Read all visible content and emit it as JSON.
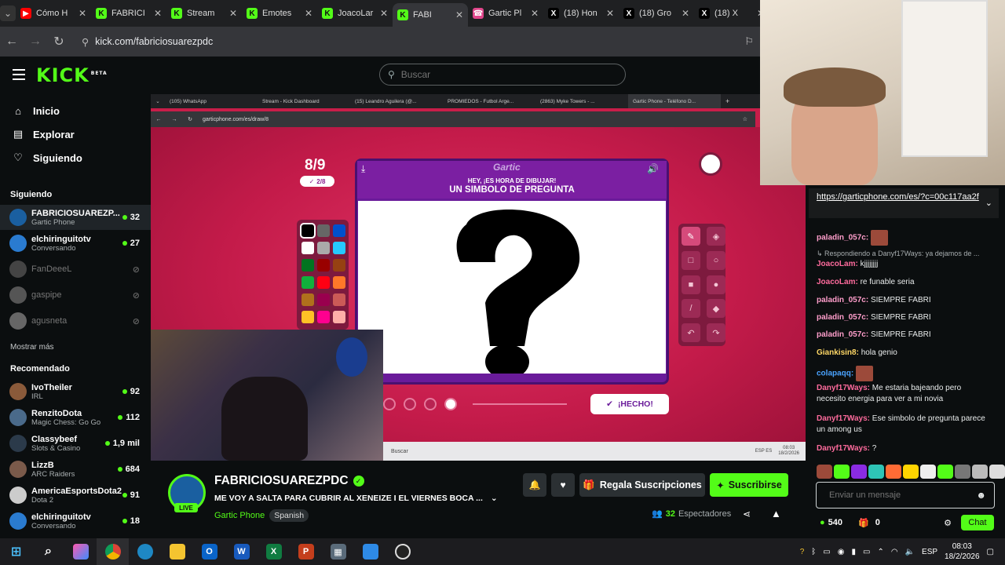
{
  "browser": {
    "tabs": [
      {
        "label": "Cómo H",
        "fav": "▶",
        "color": "#ff0000"
      },
      {
        "label": "FABRICI",
        "fav": "K",
        "color": "#53fc18"
      },
      {
        "label": "Stream",
        "fav": "K",
        "color": "#53fc18"
      },
      {
        "label": "Emotes",
        "fav": "K",
        "color": "#53fc18"
      },
      {
        "label": "JoacoLar",
        "fav": "K",
        "color": "#53fc18"
      },
      {
        "label": "FABI",
        "fav": "K",
        "color": "#53fc18"
      },
      {
        "label": "Gartic Pl",
        "fav": "☎",
        "color": "#e0468b"
      },
      {
        "label": "(18) Hon",
        "fav": "X",
        "color": "#000000"
      },
      {
        "label": "(18) Gro",
        "fav": "X",
        "color": "#000000"
      },
      {
        "label": "(18) X",
        "fav": "X",
        "color": "#000000"
      }
    ],
    "url": "kick.com/fabriciosuarezpdc"
  },
  "kick": {
    "logo": "KICK",
    "logo_beta": "BETA",
    "search_placeholder": "Buscar",
    "nav": [
      {
        "label": "Inicio"
      },
      {
        "label": "Explorar"
      },
      {
        "label": "Siguiendo"
      }
    ],
    "following_header": "Siguiendo",
    "following": [
      {
        "name": "FABRICIOSUAREZP...",
        "cat": "Gartic Phone",
        "viewers": "32",
        "live": true,
        "color": "#1a5fa0"
      },
      {
        "name": "elchiringuitotv",
        "cat": "Conversando",
        "viewers": "27",
        "live": true,
        "color": "#2a7bd0"
      },
      {
        "name": "FanDeeeL",
        "cat": "",
        "viewers": "",
        "live": false,
        "color": "#444"
      },
      {
        "name": "gaspipe",
        "cat": "",
        "viewers": "",
        "live": false,
        "color": "#555"
      },
      {
        "name": "agusneta",
        "cat": "",
        "viewers": "",
        "live": false,
        "color": "#666"
      }
    ],
    "show_more": "Mostrar más",
    "recommended_header": "Recomendado",
    "recommended": [
      {
        "name": "IvoTheiler",
        "cat": "IRL",
        "viewers": "92",
        "color": "#8a5a3a"
      },
      {
        "name": "RenzitoDota",
        "cat": "Magic Chess: Go Go",
        "viewers": "112",
        "color": "#4a6a8a"
      },
      {
        "name": "Classybeef",
        "cat": "Slots & Casino",
        "viewers": "1,9 mil",
        "color": "#2b3a4a"
      },
      {
        "name": "LizzB",
        "cat": "ARC Raiders",
        "viewers": "684",
        "color": "#7a5a4a"
      },
      {
        "name": "AmericaEsportsDota2",
        "cat": "Dota 2",
        "viewers": "91",
        "color": "#cccccc"
      },
      {
        "name": "elchiringuitotv",
        "cat": "Conversando",
        "viewers": "18",
        "color": "#2a7bd0"
      }
    ]
  },
  "stream_view": {
    "inner_tabs": [
      "(105) WhatsApp",
      "Stream - Kick Dashboard",
      "(15) Leandro Aguilera (@...",
      "PROMIEDOS - Futbol Arge...",
      "(2863) Myke Towers - ...",
      "Gartic Phone - Teléfono D..."
    ],
    "inner_url": "garticphone.com/es/draw/8",
    "round": "8/9",
    "round_sub": "2/8",
    "game_logo": "Gartic",
    "hey": "HEY, ¡ES HORA DE DIBUJAR!",
    "prompt": "UN SIMBOLO DE PREGUNTA",
    "done_label": "¡HECHO!",
    "inner_search": "Buscar",
    "inner_lang": "ESP ES",
    "inner_time": "08:03",
    "inner_date": "18/2/2026",
    "palette": [
      "#000000",
      "#666666",
      "#0050cd",
      "#ffffff",
      "#aaaaaa",
      "#26c9ff",
      "#017420",
      "#990000",
      "#964112",
      "#11b03c",
      "#ff0013",
      "#ff7829",
      "#b0701c",
      "#99004e",
      "#cb5a57",
      "#ffc126",
      "#ff008f",
      "#feafa8"
    ]
  },
  "channel": {
    "name": "FABRICIOSUAREZPDC",
    "live": "LIVE",
    "title": "ME VOY A SALTA PARA CUBRIR AL XENEIZE I EL VIERNES BOCA ...",
    "category": "Gartic Phone",
    "language": "Spanish",
    "gift_label": "Regala Suscripciones",
    "subscribe_label": "Suscribirse",
    "viewers": "32",
    "viewers_label": "Espectadores"
  },
  "chat": {
    "pinned_link": "https://garticphone.com/es/?c=00c117aa2f",
    "messages": [
      {
        "user": "paladin_057c:",
        "color": "#ff9ecb",
        "text": "",
        "emote": true
      },
      {
        "reply": "Respondiendo a Danyf17Ways: ya dejamos de ..."
      },
      {
        "user": "JoacoLam:",
        "color": "#ff6b9d",
        "text": "kjjjjjjjj"
      },
      {
        "user": "JoacoLam:",
        "color": "#ff6b9d",
        "text": "re funable seria"
      },
      {
        "user": "paladin_057c:",
        "color": "#ff9ecb",
        "text": "SIEMPRE FABRI"
      },
      {
        "user": "paladin_057c:",
        "color": "#ff9ecb",
        "text": "SIEMPRE FABRI"
      },
      {
        "user": "paladin_057c:",
        "color": "#ff9ecb",
        "text": "SIEMPRE FABRI"
      },
      {
        "user": "Giankisin8:",
        "color": "#ffd866",
        "text": "hola genio"
      },
      {
        "user": "colapaqq:",
        "color": "#4aa3ff",
        "text": "",
        "emote": true
      },
      {
        "user": "Danyf17Ways:",
        "color": "#ff6b9d",
        "text": "Me estaria bajeando pero necesito energia para ver a mi novia"
      },
      {
        "user": "Danyf17Ways:",
        "color": "#ff6b9d",
        "text": "Ese simbolo de pregunta parece un among us"
      },
      {
        "user": "Danyf17Ways:",
        "color": "#ff6b9d",
        "text": "?"
      }
    ],
    "input_placeholder": "Enviar un mensaje",
    "points": "540",
    "gifts": "0",
    "chat_button": "Chat"
  },
  "taskbar": {
    "lang": "ESP",
    "time": "08:03",
    "date": "18/2/2026"
  }
}
